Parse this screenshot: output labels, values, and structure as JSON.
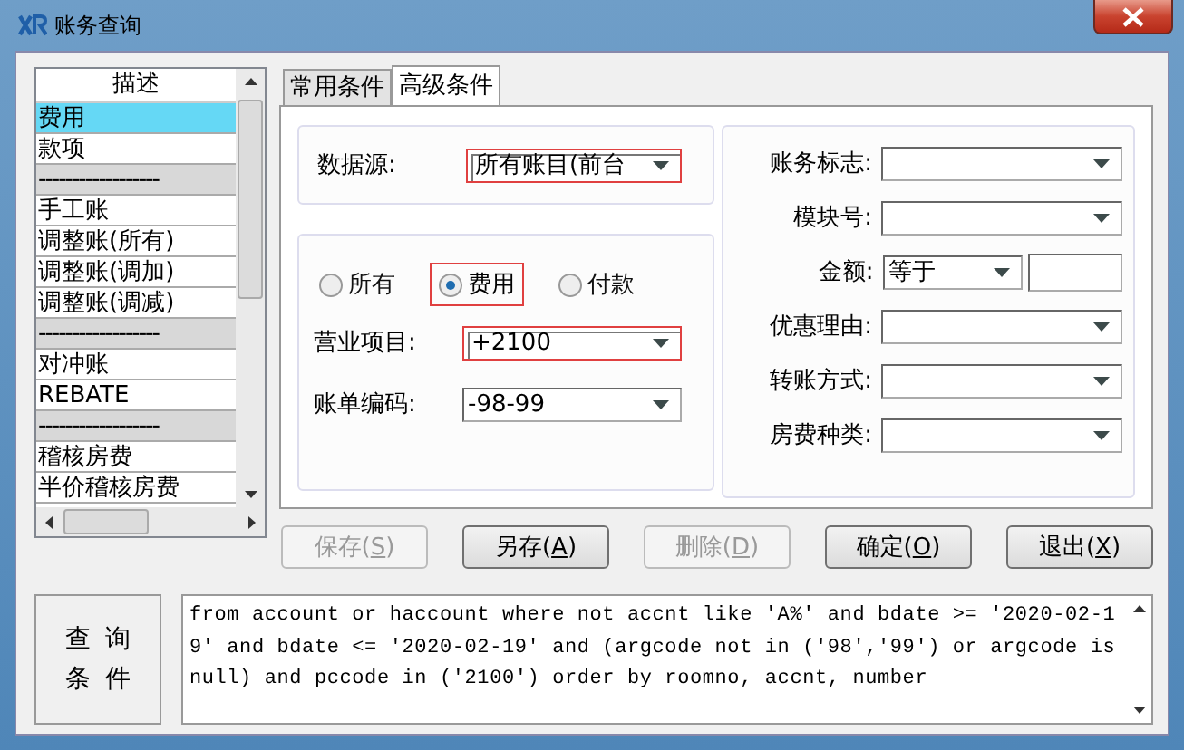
{
  "window": {
    "title": "账务查询"
  },
  "list": {
    "header": "描述",
    "items": [
      {
        "text": "费用",
        "kind": "item",
        "selected": true
      },
      {
        "text": "款项",
        "kind": "item",
        "selected": false
      },
      {
        "text": "------------------",
        "kind": "separator",
        "selected": false
      },
      {
        "text": "手工账",
        "kind": "item",
        "selected": false
      },
      {
        "text": "调整账(所有)",
        "kind": "item",
        "selected": false
      },
      {
        "text": "调整账(调加)",
        "kind": "item",
        "selected": false
      },
      {
        "text": "调整账(调减)",
        "kind": "item",
        "selected": false
      },
      {
        "text": "------------------",
        "kind": "separator",
        "selected": false
      },
      {
        "text": "对冲账",
        "kind": "item",
        "selected": false
      },
      {
        "text": "REBATE",
        "kind": "item",
        "selected": false
      },
      {
        "text": "------------------",
        "kind": "separator",
        "selected": false
      },
      {
        "text": "稽核房费",
        "kind": "item",
        "selected": false
      },
      {
        "text": "半价稽核房费",
        "kind": "item",
        "selected": false
      }
    ]
  },
  "tabs": [
    {
      "label": "常用条件",
      "selected": false
    },
    {
      "label": "高级条件",
      "selected": true
    }
  ],
  "data_source": {
    "label": "数据源:",
    "value": "所有账目(前台",
    "highlighted": true
  },
  "radios": [
    {
      "label": "所有",
      "selected": false,
      "highlighted": false
    },
    {
      "label": "费用",
      "selected": true,
      "highlighted": true
    },
    {
      "label": "付款",
      "selected": false,
      "highlighted": false
    }
  ],
  "left_fields": [
    {
      "label": "营业项目:",
      "value": "+2100",
      "highlighted": true
    },
    {
      "label": "账单编码:",
      "value": "-98-99",
      "highlighted": false
    }
  ],
  "right_fields": [
    {
      "label": "账务标志:",
      "kind": "combo"
    },
    {
      "label": "模块号:",
      "kind": "combo"
    },
    {
      "label": "金额:",
      "kind": "amount",
      "value": "等于"
    },
    {
      "label": "优惠理由:",
      "kind": "combo"
    },
    {
      "label": "转账方式:",
      "kind": "combo"
    },
    {
      "label": "房费种类:",
      "kind": "combo"
    }
  ],
  "buttons": [
    {
      "label": "保存(S)",
      "disabled": true
    },
    {
      "label": "另存(A)",
      "disabled": false
    },
    {
      "label": "删除(D)",
      "disabled": true
    },
    {
      "label": "确定(O)",
      "disabled": false
    },
    {
      "label": "退出(X)",
      "disabled": false
    }
  ],
  "query": {
    "label": "查询条件",
    "text": "from account or haccount where not accnt like 'A%' and bdate >= '2020-02-19' and bdate <= '2020-02-19' and (argcode not in ('98','99') or argcode is null) and pccode in ('2100') order by roomno, accnt, number"
  }
}
